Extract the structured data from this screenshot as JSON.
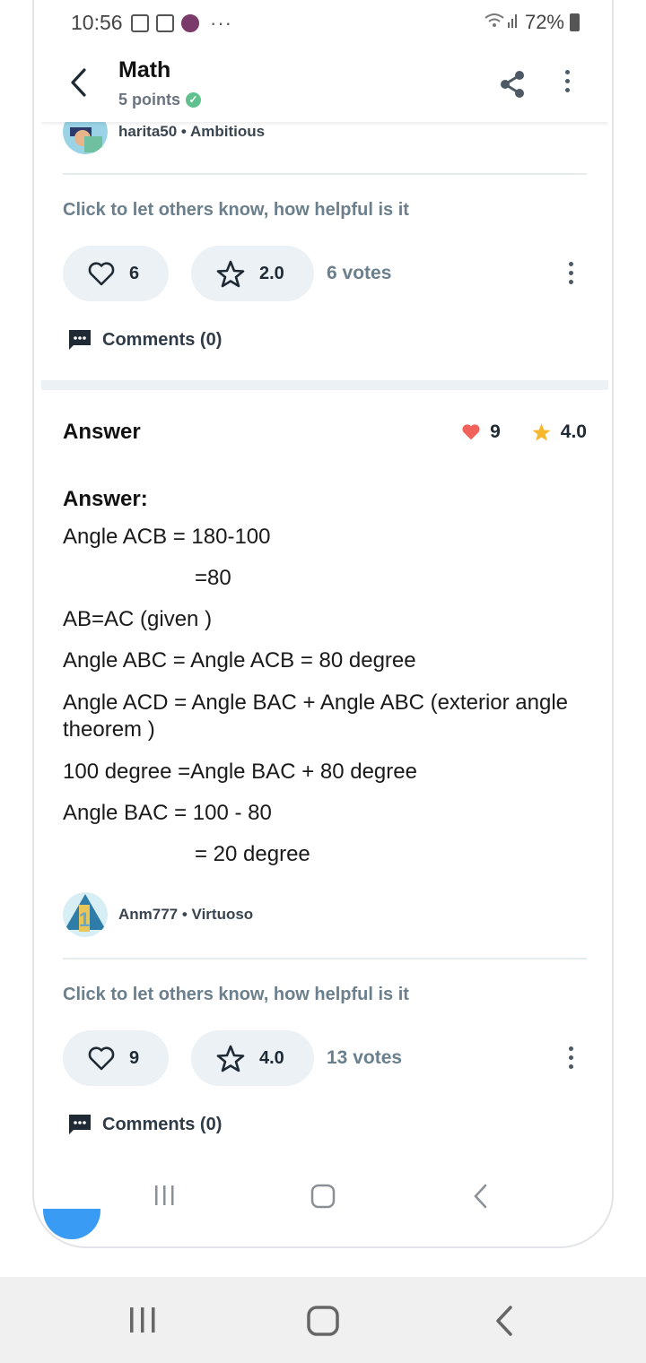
{
  "status_bar": {
    "time": "10:56",
    "dots": "···",
    "battery": "72%"
  },
  "header": {
    "title": "Math",
    "points": "5 points"
  },
  "first_answer": {
    "author_name": "harita50",
    "author_rank": "Ambitious",
    "helpful_prompt": "Click to let others know, how helpful is it",
    "likes": "6",
    "rating": "2.0",
    "votes": "6 votes",
    "comments": "Comments (0)"
  },
  "second_answer": {
    "title": "Answer",
    "likes": "9",
    "rating": "4.0",
    "heading": "Answer:",
    "lines": [
      "Angle ACB = 180-100",
      "=80",
      "AB=AC (given )",
      "Angle ABC = Angle ACB = 80 degree",
      "Angle ACD = Angle BAC + Angle ABC   (exterior angle theorem )",
      "100 degree  =Angle BAC + 80 degree",
      "Angle BAC = 100 - 80",
      "= 20 degree"
    ],
    "author_name": "Anm777",
    "author_rank": "Virtuoso",
    "helpful_prompt": "Click to let others know, how helpful is it",
    "pill_likes": "9",
    "pill_rating": "4.0",
    "votes": "13 votes",
    "comments": "Comments (0)"
  },
  "colors": {
    "accent": "#ebf1f5",
    "heart": "#f0625a",
    "star": "#f5b82e",
    "check": "#60c08e"
  }
}
